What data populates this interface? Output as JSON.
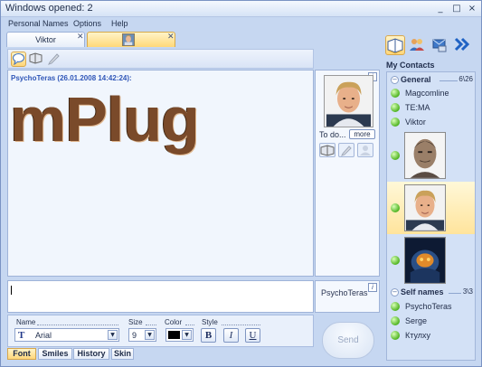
{
  "window": {
    "title": "Windows opened: 2"
  },
  "menu": {
    "items": [
      "Personal Names",
      "Options",
      "Help"
    ]
  },
  "tabs": [
    {
      "label": "Viktor",
      "active": false
    },
    {
      "label": "",
      "active": true
    }
  ],
  "chat": {
    "message_header": "PsychoTeras (26.01.2008 14:42:24):",
    "message_body": "mPlug"
  },
  "info": {
    "todo_label": "To do...",
    "more_label": "more"
  },
  "self": {
    "name": "PsychoTeras"
  },
  "format": {
    "name_label": "Name",
    "size_label": "Size",
    "color_label": "Color",
    "style_label": "Style",
    "font_value": "Arial",
    "size_value": "9",
    "color_value": "#000000",
    "bold_label": "B",
    "italic_label": "I",
    "underline_label": "U"
  },
  "bottom_tabs": [
    "Font",
    "Smiles",
    "History",
    "Skin"
  ],
  "send_label": "Send",
  "contacts": {
    "title": "My Contacts",
    "groups": [
      {
        "name": "General",
        "count": "6\\26",
        "items": [
          "Magcomline",
          "TE:MA",
          "Viktor"
        ]
      },
      {
        "name": "Self names",
        "count": "3\\3",
        "items": [
          "PsychoTeras",
          "Serge",
          "Ктулху"
        ]
      }
    ]
  },
  "colors": {
    "accent": "#ffd67a",
    "background": "#c6d7f1",
    "status_online": "#4fb421",
    "header_text": "#2f56b8"
  }
}
